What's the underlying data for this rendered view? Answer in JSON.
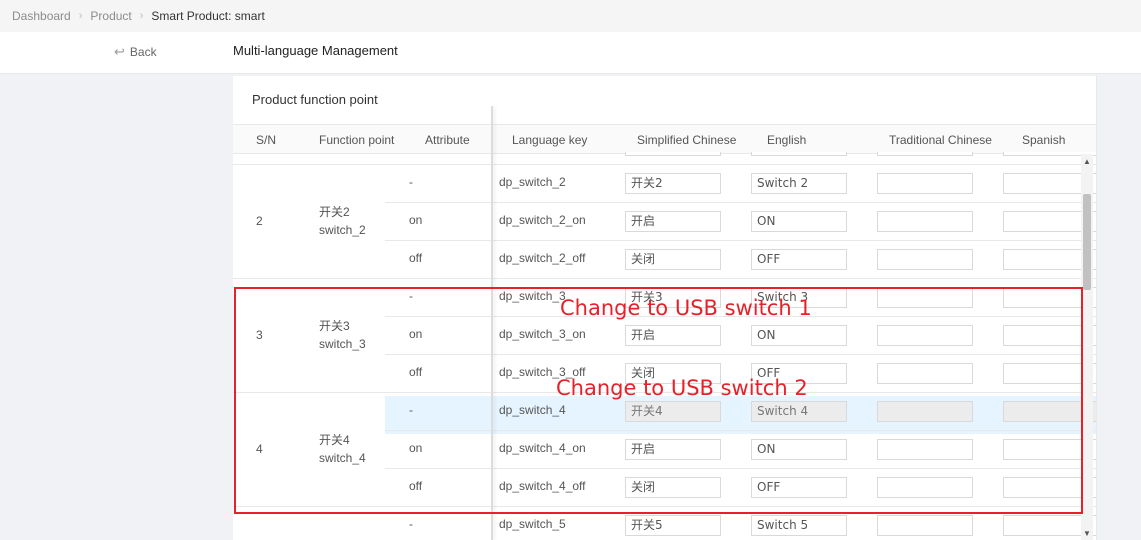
{
  "breadcrumb": {
    "items": [
      "Dashboard",
      "Product",
      "Smart Product: smart"
    ]
  },
  "header": {
    "back_label": "Back",
    "title": "Multi-language Management"
  },
  "card": {
    "title": "Product function point",
    "columns": [
      "S/N",
      "Function point",
      "Attribute",
      "Language key",
      "Simplified Chinese",
      "English",
      "Traditional Chinese",
      "Spanish"
    ]
  },
  "rows": [
    {
      "sn": "2",
      "fp_cn": "开关2",
      "fp_en": "switch_2",
      "attrs": [
        {
          "attr": "-",
          "key": "dp_switch_2",
          "zh": "开关2",
          "en": "Switch 2"
        },
        {
          "attr": "on",
          "key": "dp_switch_2_on",
          "zh": "开启",
          "en": "ON"
        },
        {
          "attr": "off",
          "key": "dp_switch_2_off",
          "zh": "关闭",
          "en": "OFF"
        }
      ]
    },
    {
      "sn": "3",
      "fp_cn": "开关3",
      "fp_en": "switch_3",
      "attrs": [
        {
          "attr": "-",
          "key": "dp_switch_3",
          "zh": "开关3",
          "en": "Switch 3"
        },
        {
          "attr": "on",
          "key": "dp_switch_3_on",
          "zh": "开启",
          "en": "ON"
        },
        {
          "attr": "off",
          "key": "dp_switch_3_off",
          "zh": "关闭",
          "en": "OFF"
        }
      ]
    },
    {
      "sn": "4",
      "fp_cn": "开关4",
      "fp_en": "switch_4",
      "attrs": [
        {
          "attr": "-",
          "key": "dp_switch_4",
          "zh": "开关4",
          "en": "Switch 4"
        },
        {
          "attr": "on",
          "key": "dp_switch_4_on",
          "zh": "开启",
          "en": "ON"
        },
        {
          "attr": "off",
          "key": "dp_switch_4_off",
          "zh": "关闭",
          "en": "OFF"
        }
      ]
    },
    {
      "attrs": [
        {
          "attr": "-",
          "key": "dp_switch_5",
          "zh": "开关5",
          "en": "Switch 5"
        }
      ]
    }
  ],
  "annotations": {
    "note1": "Change to USB switch 1",
    "note2": "Change to USB switch 2"
  },
  "colors": {
    "annotation": "#e8202a",
    "row_highlight": "#e6f4ff"
  },
  "icons": {
    "back": "back-arrow-icon",
    "breadcrumb_separator": "chevron-right-icon",
    "scroll_up": "triangle-up-icon",
    "scroll_down": "triangle-down-icon"
  }
}
